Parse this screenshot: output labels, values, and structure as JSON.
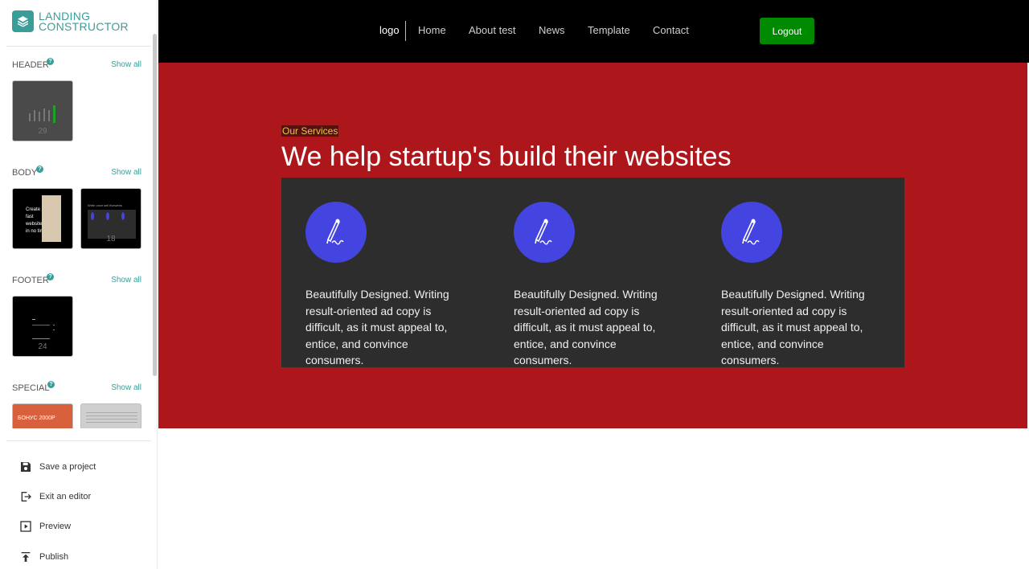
{
  "brand": {
    "line1": "LANDING",
    "line2": "CONSTRUCTOR"
  },
  "sidebar": {
    "sections": [
      {
        "title": "HEADER",
        "help": "?",
        "show_all": "Show all",
        "thumbs": [
          {
            "count": "29",
            "bg": "#4a4a4a"
          }
        ]
      },
      {
        "title": "BODY",
        "help": "?",
        "show_all": "Show all",
        "thumbs": [
          {
            "count": "",
            "bg": "#000000"
          },
          {
            "count": "18",
            "bg": "#000000"
          }
        ]
      },
      {
        "title": "FOOTER",
        "help": "?",
        "show_all": "Show all",
        "thumbs": [
          {
            "count": "24",
            "bg": "#000000"
          }
        ]
      },
      {
        "title": "SPECIAL",
        "help": "?",
        "show_all": "Show all",
        "thumbs": [
          {
            "text": "БОНУС 2000Р",
            "bg": "#d9603c"
          },
          {
            "bg": "#cfcfcf"
          }
        ]
      }
    ],
    "thumb_text": {
      "body_1_a": "Create",
      "body_1_b": "fast",
      "body_1_c": "websites",
      "body_1_d": "in no time",
      "body_2_title": "Write once sell fivewebs"
    },
    "actions": [
      {
        "label": "Save a project",
        "icon": "save-icon"
      },
      {
        "label": "Exit an editor",
        "icon": "exit-icon"
      },
      {
        "label": "Preview",
        "icon": "preview-icon"
      },
      {
        "label": "Publish",
        "icon": "publish-icon"
      }
    ]
  },
  "topnav": {
    "logo": "logo",
    "links": [
      "Home",
      "About test",
      "News",
      "Template",
      "Contact"
    ],
    "logout": "Logout"
  },
  "hero": {
    "eyebrow": "Our Services",
    "title": "We help startup's build their websites",
    "cards": [
      {
        "text": "Beautifully Designed. Writing result-oriented ad copy is difficult, as it must appeal to, entice, and convince consumers.",
        "icon": "pen-signature-icon"
      },
      {
        "text": "Beautifully Designed. Writing result-oriented ad copy is difficult, as it must appeal to, entice, and convince consumers.",
        "icon": "pen-signature-icon"
      },
      {
        "text": "Beautifully Designed. Writing result-oriented ad copy is difficult, as it must appeal to, entice, and convince consumers.",
        "icon": "pen-signature-icon"
      }
    ]
  },
  "colors": {
    "brand": "#3a9e98",
    "hero_bg": "#ad171c",
    "cards_bg": "#2d2d2d",
    "icon_circle": "#4444e0",
    "logout_bg": "#008a00",
    "topbar_bg": "#000000"
  }
}
